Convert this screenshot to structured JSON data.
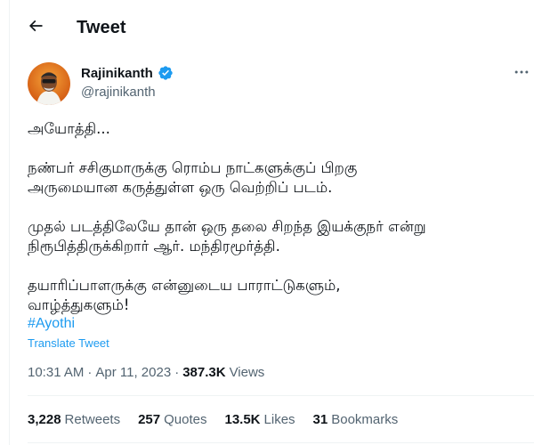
{
  "header": {
    "title": "Tweet",
    "back_icon": "arrow-left-icon"
  },
  "author": {
    "name": "Rajinikanth",
    "handle": "@rajinikanth",
    "verified": true,
    "verified_color": "#1d9bf0"
  },
  "tweet": {
    "paragraphs": [
      "அயோத்தி...",
      "நண்பர் சசிகுமாருக்கு ரொம்ப நாட்களுக்குப் பிறகு\nஅருமையான கருத்துள்ள ஒரு வெற்றிப் படம்.",
      "முதல் படத்திலேயே தான் ஒரு தலை சிறந்த இயக்குநர் என்று\nநிரூபித்திருக்கிறார் ஆர். மந்திரமூர்த்தி.",
      "தயாரிப்பாளருக்கு என்னுடைய பாராட்டுகளும்,\nவாழ்த்துகளும்!"
    ],
    "hashtag": "#Ayothi",
    "translate_label": "Translate Tweet",
    "time": "10:31 AM",
    "separator": "·",
    "date": "Apr 11, 2023",
    "views_count": "387.3K",
    "views_label": "Views"
  },
  "stats": {
    "retweets_count": "3,228",
    "retweets_label": "Retweets",
    "quotes_count": "257",
    "quotes_label": "Quotes",
    "likes_count": "13.5K",
    "likes_label": "Likes",
    "bookmarks_count": "31",
    "bookmarks_label": "Bookmarks"
  },
  "colors": {
    "link": "#1d9bf0",
    "secondary_text": "#536471",
    "primary_text": "#0f1419",
    "divider": "#eff3f4"
  }
}
